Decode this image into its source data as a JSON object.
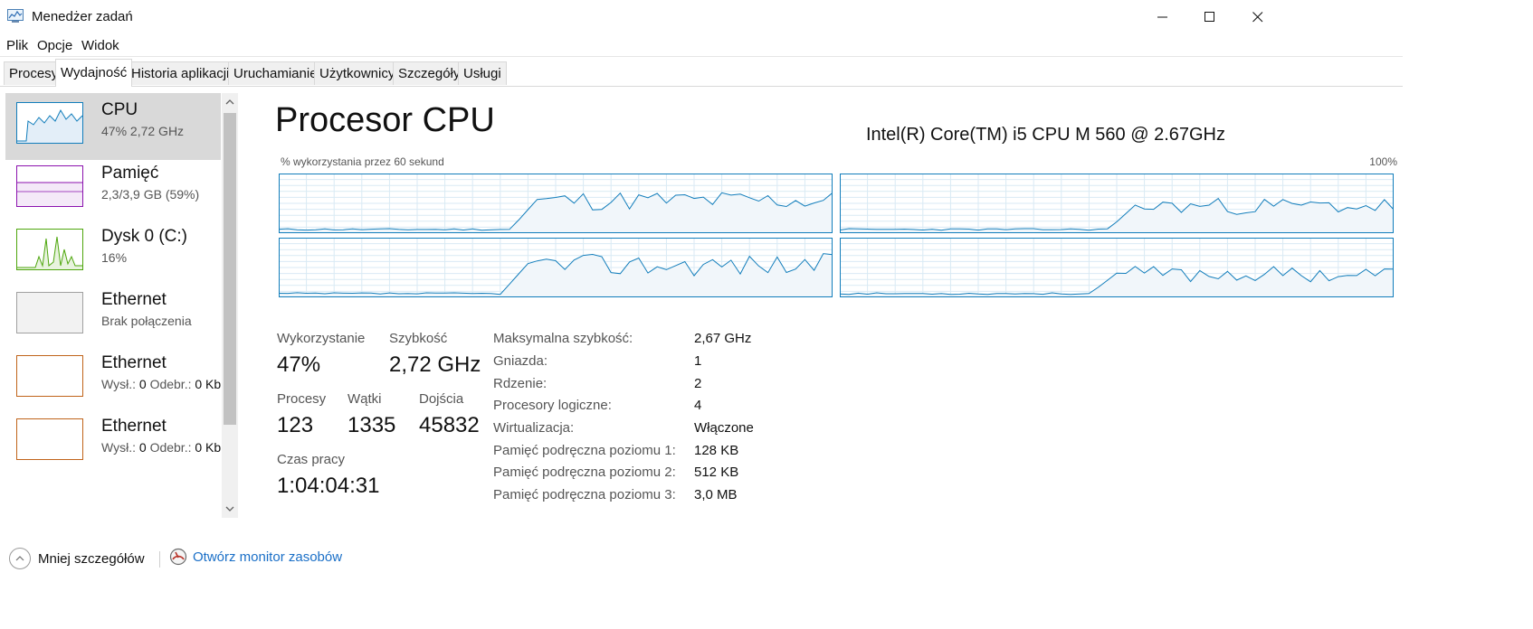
{
  "window": {
    "title": "Menedżer zadań"
  },
  "menu": {
    "file": "Plik",
    "options": "Opcje",
    "view": "Widok"
  },
  "tabs": [
    {
      "label": "Procesy",
      "active": false
    },
    {
      "label": "Wydajność",
      "active": true
    },
    {
      "label": "Historia aplikacji",
      "active": false
    },
    {
      "label": "Uruchamianie",
      "active": false
    },
    {
      "label": "Użytkownicy",
      "active": false
    },
    {
      "label": "Szczegóły",
      "active": false
    },
    {
      "label": "Usługi",
      "active": false
    }
  ],
  "sidebar": {
    "items": [
      {
        "name": "CPU",
        "sub": "47%  2,72 GHz",
        "color": "#117dbb",
        "selected": true
      },
      {
        "name": "Pamięć",
        "sub": "2,3/3,9 GB (59%)",
        "color": "#8b12ae",
        "selected": false
      },
      {
        "name": "Dysk 0 (C:)",
        "sub": "16%",
        "color": "#4da60c",
        "selected": false
      },
      {
        "name": "Ethernet",
        "sub": "Brak połączenia",
        "color": "#a0a0a0",
        "selected": false
      },
      {
        "name": "Ethernet",
        "sub_label1": "Wysł.:",
        "sub_val1": "0",
        "sub_label2": "Odebr.:",
        "sub_val2": "0 Kb",
        "color": "#c0631a",
        "selected": false
      },
      {
        "name": "Ethernet",
        "sub_label1": "Wysł.:",
        "sub_val1": "0",
        "sub_label2": "Odebr.:",
        "sub_val2": "0 Kb",
        "color": "#c0631a",
        "selected": false
      }
    ]
  },
  "main": {
    "title": "Procesor CPU",
    "model": "Intel(R) Core(TM) i5 CPU M 560 @ 2.67GHz",
    "graph_label": "% wykorzystania przez 60 sekund",
    "graph_max": "100%",
    "graph_color": "#117dbb",
    "graph_fill": "#f1f6fa",
    "grid_color": "#d9eaf4"
  },
  "stats": {
    "utilization_label": "Wykorzystanie",
    "utilization_value": "47%",
    "speed_label": "Szybkość",
    "speed_value": "2,72 GHz",
    "processes_label": "Procesy",
    "processes_value": "123",
    "threads_label": "Wątki",
    "threads_value": "1335",
    "handles_label": "Dojścia",
    "handles_value": "45832",
    "uptime_label": "Czas pracy",
    "uptime_value": "1:04:04:31"
  },
  "specs": [
    {
      "label": "Maksymalna szybkość:",
      "value": "2,67 GHz"
    },
    {
      "label": "Gniazda:",
      "value": "1"
    },
    {
      "label": "Rdzenie:",
      "value": "2"
    },
    {
      "label": "Procesory logiczne:",
      "value": "4"
    },
    {
      "label": "Wirtualizacja:",
      "value": "Włączone"
    },
    {
      "label": "Pamięć podręczna poziomu 1:",
      "value": "128 KB"
    },
    {
      "label": "Pamięć podręczna poziomu 2:",
      "value": "512 KB"
    },
    {
      "label": "Pamięć podręczna poziomu 3:",
      "value": "3,0 MB"
    }
  ],
  "footer": {
    "fewer_details": "Mniej szczegółów",
    "open_monitor": "Otwórz monitor zasobów"
  }
}
